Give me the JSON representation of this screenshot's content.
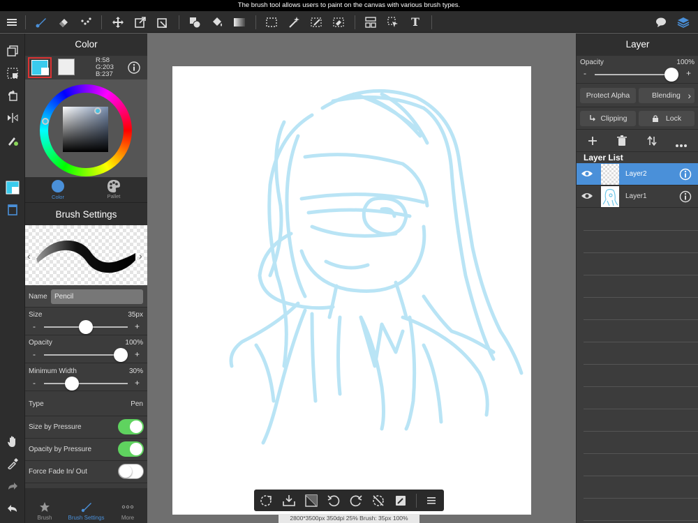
{
  "tip": "The brush tool allows users to paint on the canvas with various brush types.",
  "toolbar": {
    "icons": [
      "menu-icon",
      "brush-icon",
      "eraser-icon",
      "dot-icon",
      "move-icon",
      "transform-icon",
      "crop-transform-icon",
      "fill-shape-icon",
      "bucket-icon",
      "gradient-icon",
      "select-rect-icon",
      "magic-wand-icon",
      "select-pen-icon",
      "select-eraser-icon",
      "layer-select-icon",
      "select-cursor-icon",
      "text-icon",
      "speech-bubble-icon",
      "layers-icon"
    ],
    "text_glyph": "T"
  },
  "color_panel": {
    "title": "Color",
    "rgb": {
      "r": "R:58",
      "g": "G:203",
      "b": "B:237"
    },
    "primary": "#3acbed",
    "tabs": [
      {
        "label": "Color"
      },
      {
        "label": "Pallet"
      }
    ]
  },
  "brush_settings": {
    "title": "Brush Settings",
    "name_label": "Name",
    "name_value": "Pencil",
    "size": {
      "label": "Size",
      "value": "35px",
      "level": 0.5
    },
    "opacity": {
      "label": "Opacity",
      "value": "100%",
      "level": 1.0
    },
    "min_width": {
      "label": "Minimum Width",
      "value": "30%",
      "level": 0.3
    },
    "type": {
      "label": "Type",
      "value": "Pen"
    },
    "size_pressure": {
      "label": "Size by Pressure",
      "on": true
    },
    "opacity_pressure": {
      "label": "Opacity by Pressure",
      "on": true
    },
    "force_fade": {
      "label": "Force Fade In/ Out",
      "on": false
    },
    "minus": "-",
    "plus": "+"
  },
  "bottom_tabs": [
    {
      "label": "Brush"
    },
    {
      "label": "Brush Settings"
    },
    {
      "label": "More"
    }
  ],
  "layer_panel": {
    "title": "Layer",
    "opacity_label": "Opacity",
    "opacity_value": "100%",
    "opacity_level": 1.0,
    "protect_alpha": "Protect Alpha",
    "blending": "Blending",
    "clipping": "Clipping",
    "lock": "Lock",
    "list_title": "Layer List",
    "layers": [
      {
        "name": "Layer2"
      },
      {
        "name": "Layer1"
      }
    ],
    "minus": "-",
    "plus": "+"
  },
  "status": "2800*3500px 350dpi 25% Brush: 35px 100%",
  "accent": "#4a90d9",
  "toggle_on": "#5fd35f",
  "sketch_color": "#b6e3f5"
}
